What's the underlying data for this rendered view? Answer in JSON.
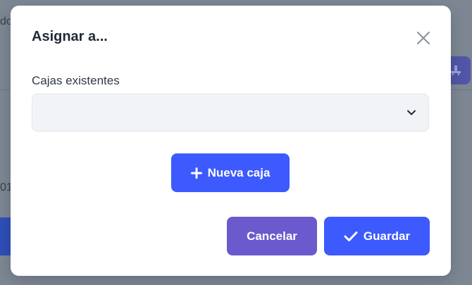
{
  "background": {
    "text_top": "do",
    "text_mid": "01"
  },
  "modal": {
    "title": "Asignar a...",
    "close_icon": "close-icon",
    "field": {
      "label": "Cajas existentes",
      "selected_value": ""
    },
    "new_box_button": {
      "label": "Nueva caja",
      "icon": "plus-icon"
    },
    "cancel_button": {
      "label": "Cancelar"
    },
    "save_button": {
      "label": "Guardar",
      "icon": "check-icon"
    }
  },
  "colors": {
    "primary": "#3d5afe",
    "cancel": "#6a5acd",
    "overlay": "#7b8591"
  }
}
